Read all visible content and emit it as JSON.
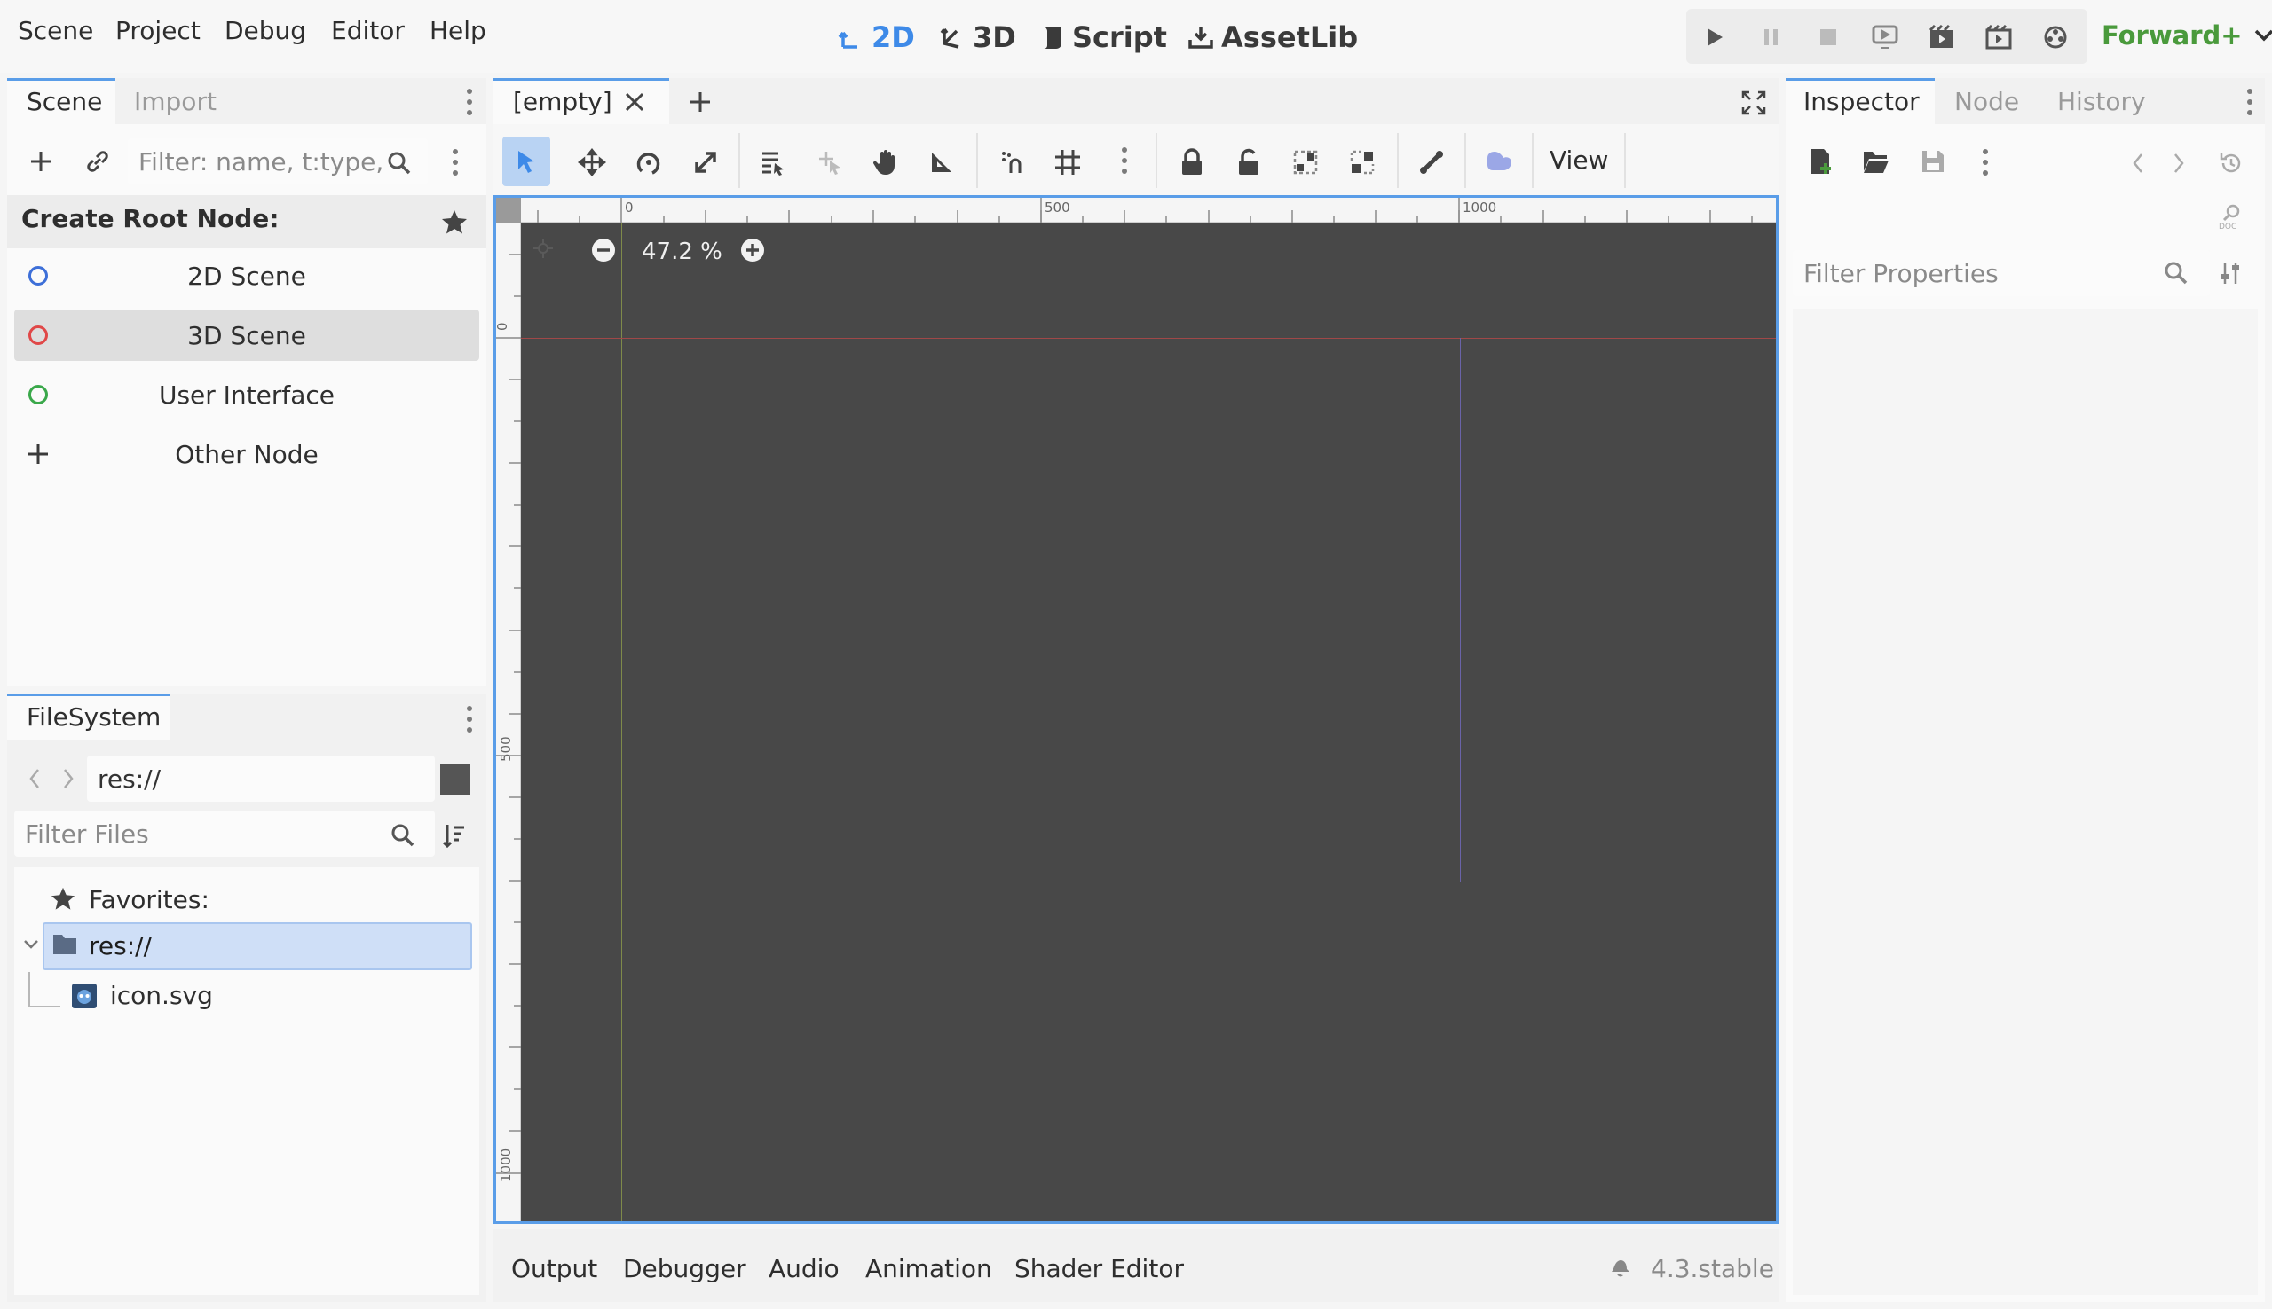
{
  "menu": [
    "Scene",
    "Project",
    "Debug",
    "Editor",
    "Help"
  ],
  "workspaces": [
    {
      "label": "2D",
      "icon": "2d-icon",
      "active": true
    },
    {
      "label": "3D",
      "icon": "3d-icon",
      "active": false
    },
    {
      "label": "Script",
      "icon": "script-icon",
      "active": false
    },
    {
      "label": "AssetLib",
      "icon": "assetlib-icon",
      "active": false
    }
  ],
  "renderer": "Forward+",
  "scene_dock": {
    "tabs": [
      "Scene",
      "Import"
    ],
    "filter_placeholder": "Filter: name, t:type,",
    "create_root_label": "Create Root Node:",
    "root_options": [
      {
        "label": "2D Scene",
        "icon": "node2d-icon",
        "color": "#3d6fd8"
      },
      {
        "label": "3D Scene",
        "icon": "node3d-icon",
        "color": "#e04848"
      },
      {
        "label": "User Interface",
        "icon": "control-icon",
        "color": "#3aa84a"
      },
      {
        "label": "Other Node",
        "icon": "plus-icon",
        "color": "#3a3a3a"
      }
    ]
  },
  "filesystem_dock": {
    "tab": "FileSystem",
    "path": "res://",
    "filter_placeholder": "Filter Files",
    "tree": {
      "favorites": "Favorites:",
      "root": "res://",
      "files": [
        "icon.svg"
      ]
    }
  },
  "editor_tabs": [
    "[empty]"
  ],
  "viewport_toolbar": {
    "view_label": "View"
  },
  "canvas": {
    "zoom": "47.2 %",
    "ruler_h": [
      "0",
      "500",
      "1000"
    ],
    "ruler_v": [
      "0",
      "500",
      "1000"
    ]
  },
  "bottom_panel": {
    "tabs": [
      "Output",
      "Debugger",
      "Audio",
      "Animation",
      "Shader Editor"
    ],
    "version": "4.3.stable"
  },
  "inspector_dock": {
    "tabs": [
      "Inspector",
      "Node",
      "History"
    ],
    "filter_placeholder": "Filter Properties"
  },
  "colors": {
    "accent": "#5a9de8",
    "viewport_bg": "#484848",
    "renderer_green": "#4a9a3c"
  }
}
